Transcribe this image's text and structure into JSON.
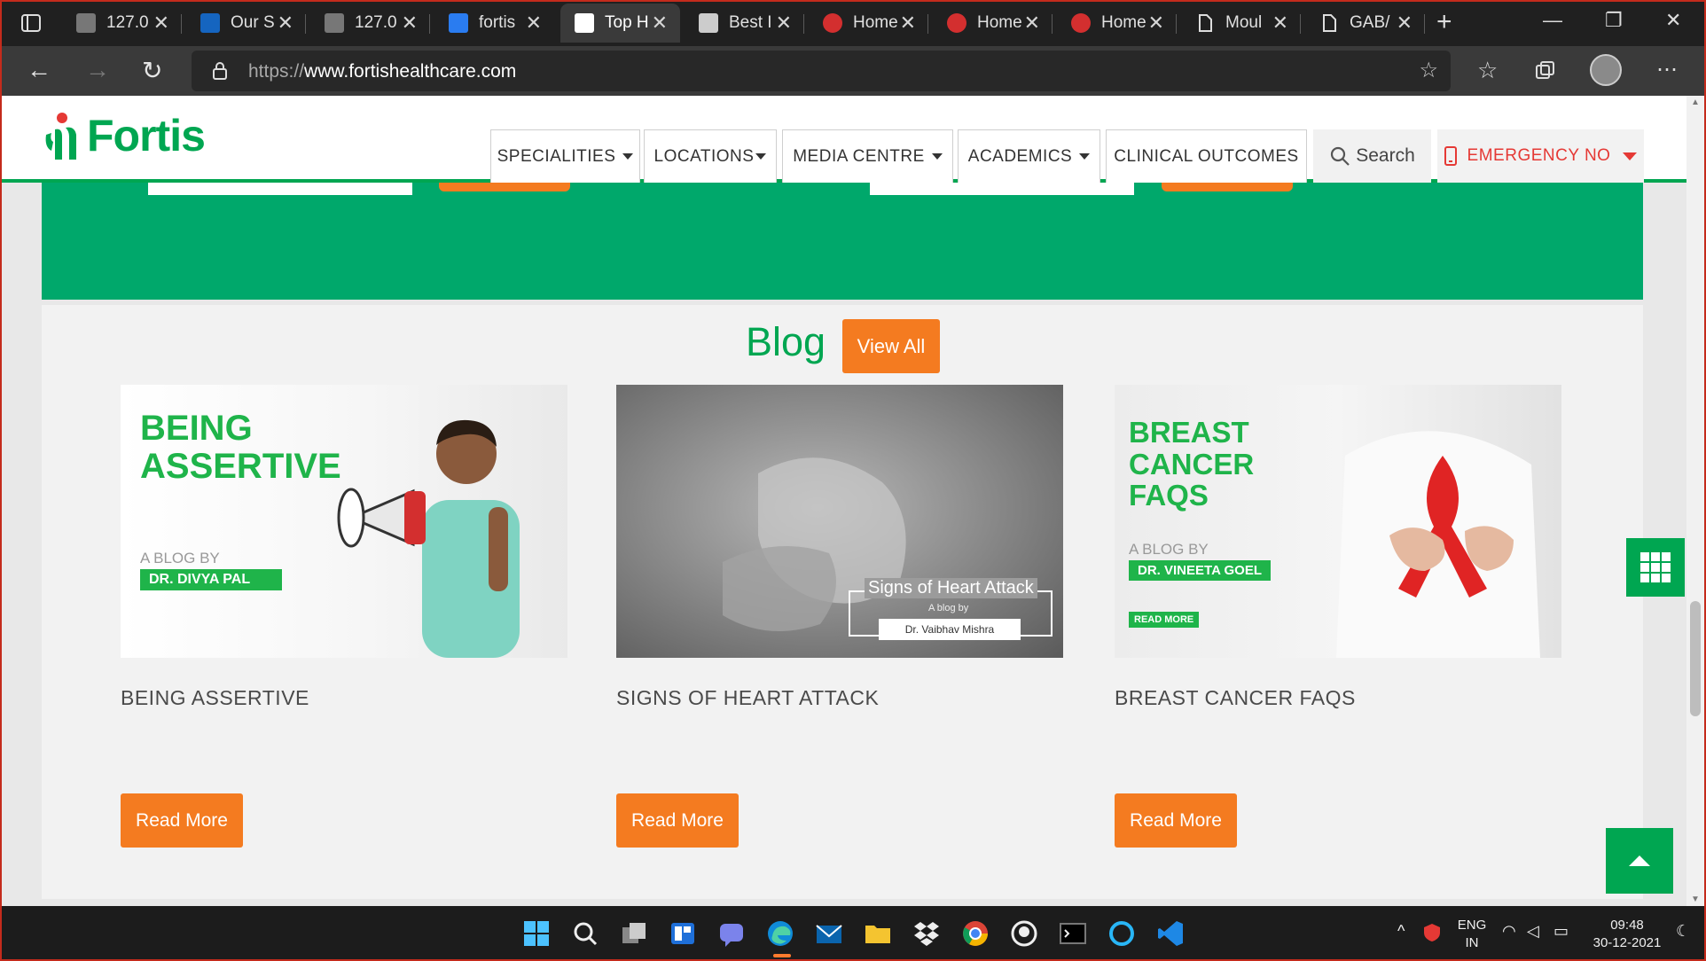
{
  "browser": {
    "tabs": [
      {
        "title": "127.0",
        "favicon": "image-favicon"
      },
      {
        "title": "Our S",
        "favicon": "star-favicon"
      },
      {
        "title": "127.0",
        "favicon": "image-favicon"
      },
      {
        "title": "fortis",
        "favicon": "bing-favicon"
      },
      {
        "title": "Top H",
        "favicon": "fortis-favicon",
        "active": true
      },
      {
        "title": "Best I",
        "favicon": "paras-favicon"
      },
      {
        "title": "Home",
        "favicon": "heart-favicon"
      },
      {
        "title": "Home",
        "favicon": "heart-favicon"
      },
      {
        "title": "Home",
        "favicon": "heart-favicon"
      },
      {
        "title": "Moul",
        "favicon": "document-favicon"
      },
      {
        "title": "GAB/",
        "favicon": "document-favicon"
      }
    ],
    "url_prefix": "https://",
    "url_host": "www.fortishealthcare.com"
  },
  "site": {
    "logo_text": "Fortis",
    "menu": {
      "specialities": "SPECIALITIES",
      "locations": "LOCATIONS",
      "media_centre": "MEDIA CENTRE",
      "academics": "ACADEMICS",
      "clinical_outcomes": "CLINICAL OUTCOMES"
    },
    "search_label": "Search",
    "emergency_label": "EMERGENCY NO"
  },
  "blog": {
    "heading": "Blog",
    "view_all": "View All",
    "cards": [
      {
        "title": "BEING ASSERTIVE",
        "read_more": "Read More",
        "image": {
          "headline_1": "BEING",
          "headline_2": "ASSERTIVE",
          "by": "A BLOG BY",
          "author": "DR. DIVYA PAL"
        }
      },
      {
        "title": "SIGNS OF HEART ATTACK",
        "read_more": "Read More",
        "image": {
          "headline": "Signs of Heart Attack",
          "by": "A blog by",
          "author": "Dr. Vaibhav Mishra"
        }
      },
      {
        "title": "BREAST CANCER FAQS",
        "read_more": "Read More",
        "image": {
          "headline_1": "BREAST",
          "headline_2": "CANCER",
          "headline_3": "FAQS",
          "by": "A BLOG BY",
          "author": "DR. VINEETA GOEL",
          "cta": "READ MORE"
        }
      }
    ]
  },
  "taskbar": {
    "lang_1": "ENG",
    "lang_2": "IN",
    "time": "09:48",
    "date": "30-12-2021"
  },
  "colors": {
    "brand_green": "#00a651",
    "band_green": "#00a86b",
    "accent_orange": "#f47b20",
    "emergency_red": "#e53935"
  }
}
